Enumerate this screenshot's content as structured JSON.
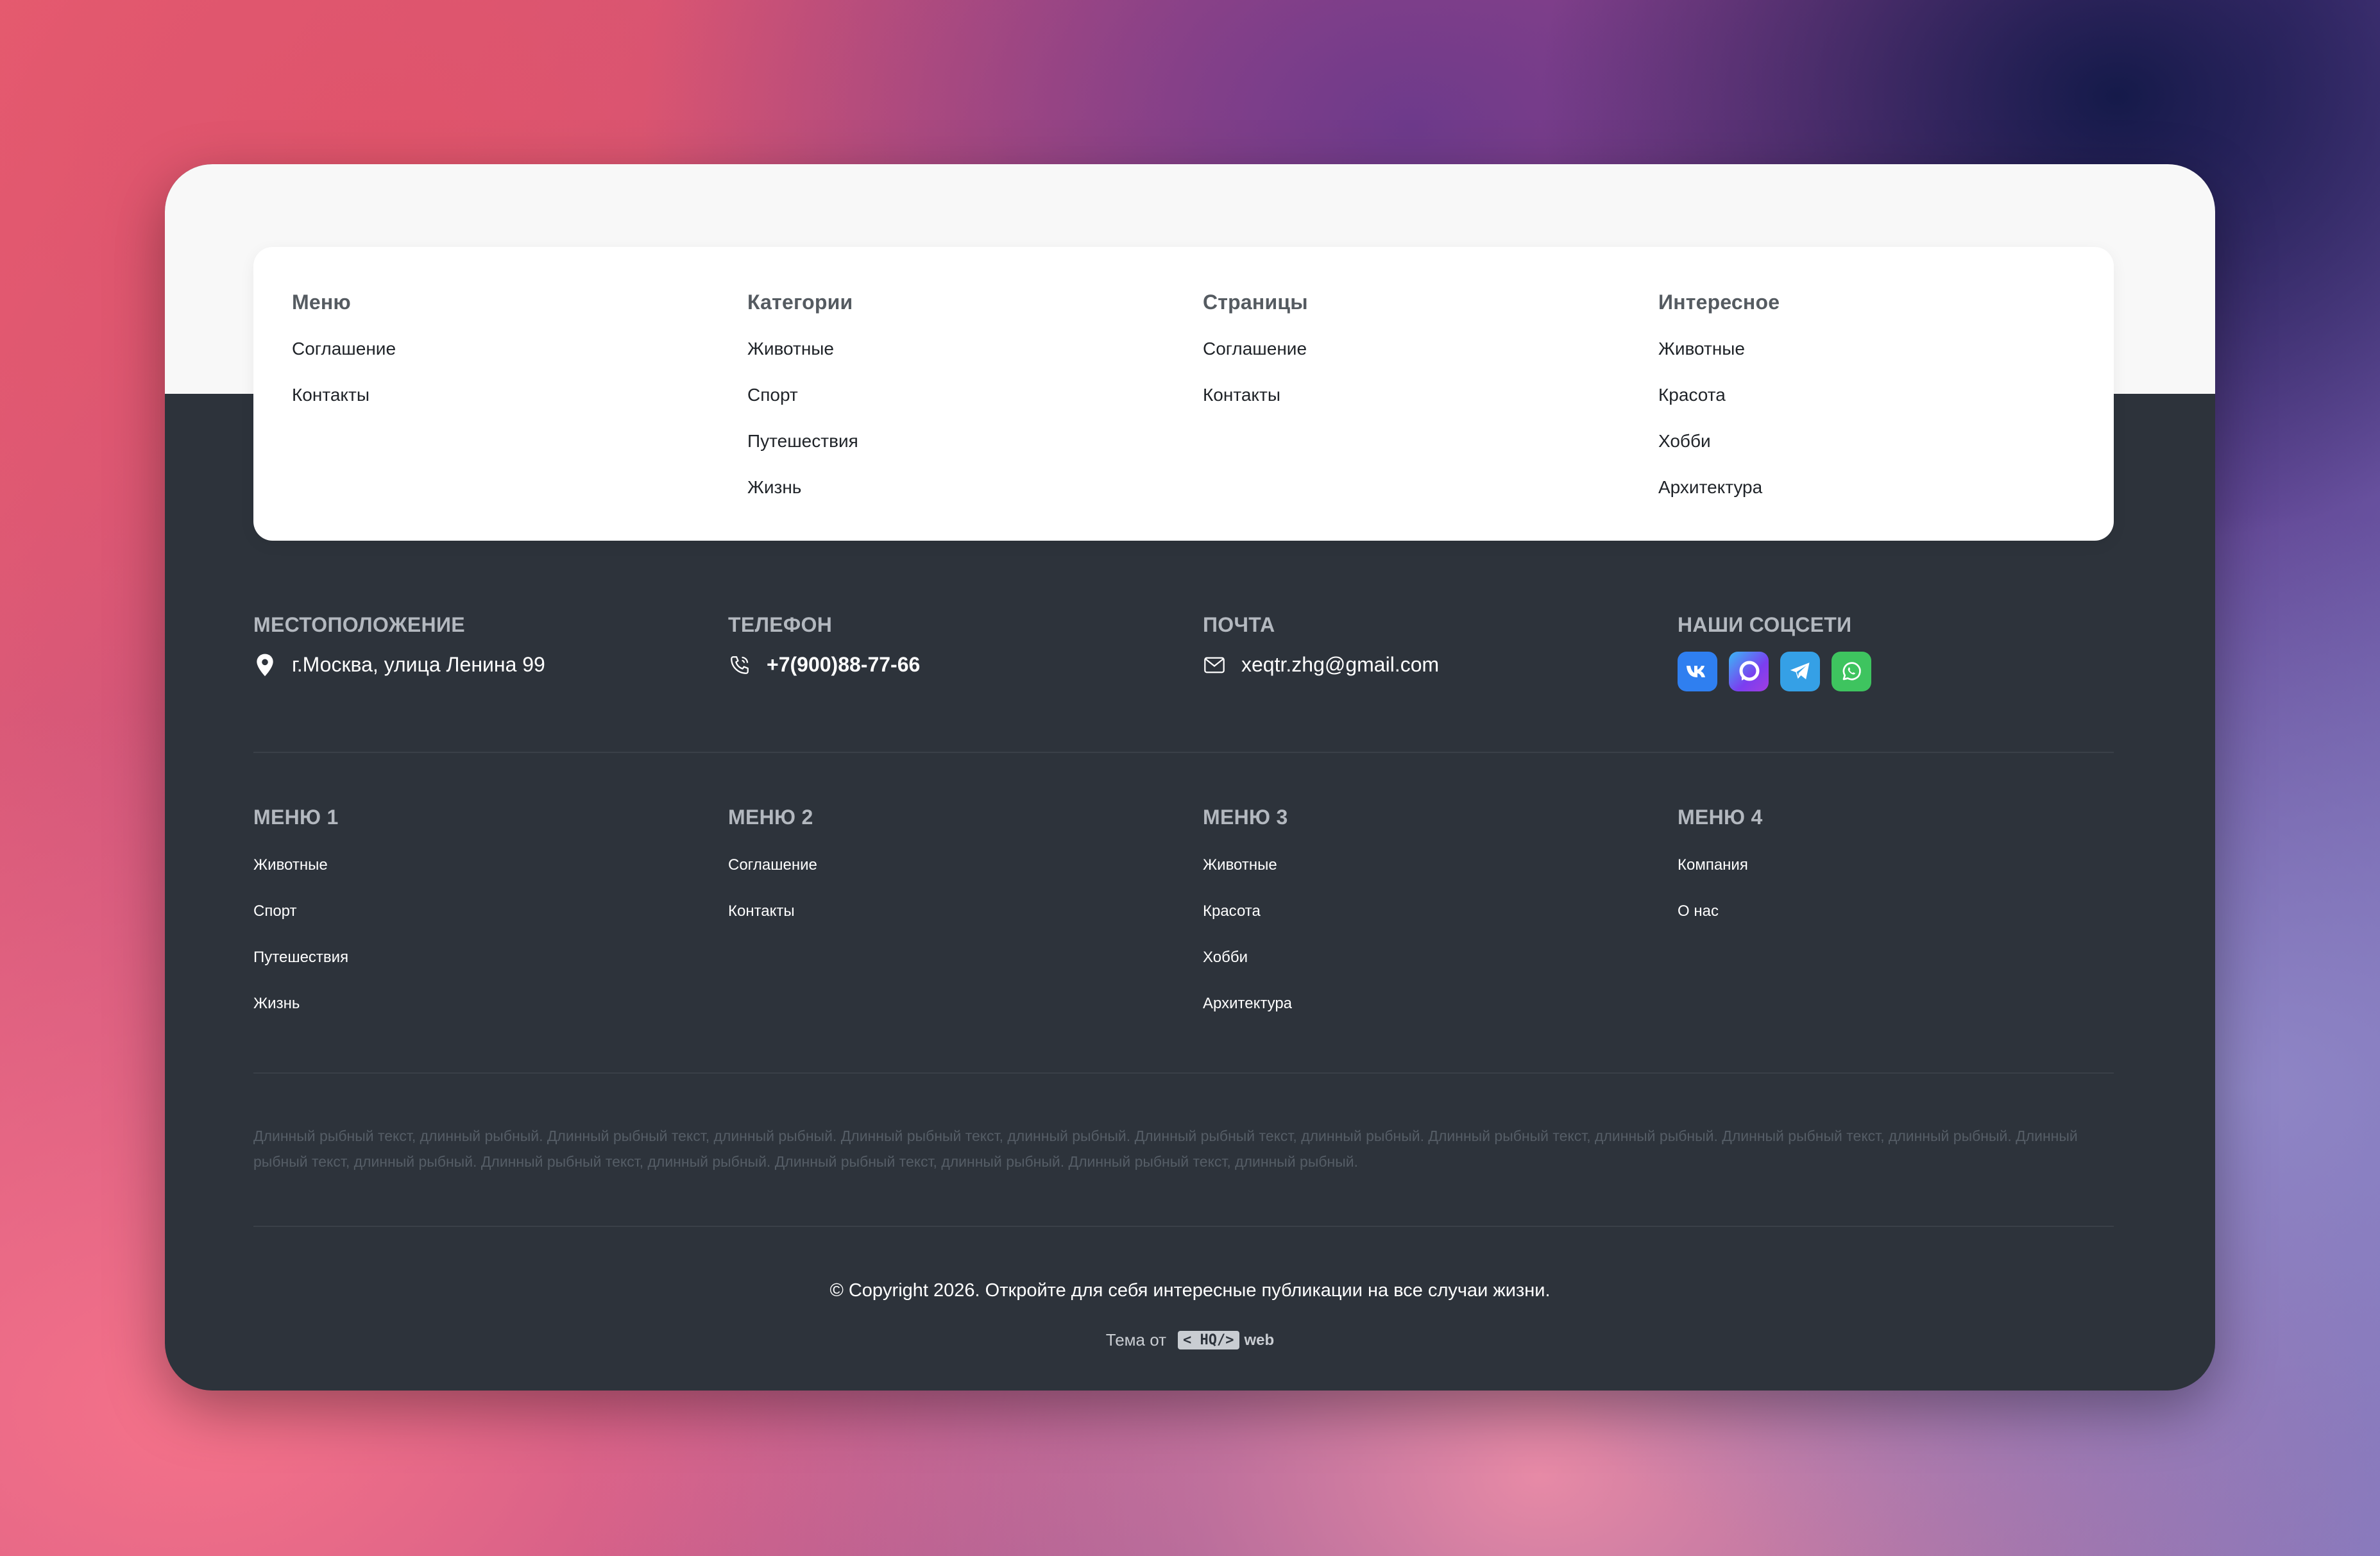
{
  "menu_panel": {
    "columns": [
      {
        "title": "Меню",
        "items": [
          "Соглашение",
          "Контакты"
        ]
      },
      {
        "title": "Категории",
        "items": [
          "Животные",
          "Спорт",
          "Путешествия",
          "Жизнь"
        ]
      },
      {
        "title": "Страницы",
        "items": [
          "Соглашение",
          "Контакты"
        ]
      },
      {
        "title": "Интересное",
        "items": [
          "Животные",
          "Красота",
          "Хобби",
          "Архитектура"
        ]
      }
    ]
  },
  "contacts": {
    "location": {
      "label": "МЕСТОПОЛОЖЕНИЕ",
      "value": "г.Москва, улица Ленина 99",
      "icon": "location-pin-icon"
    },
    "phone": {
      "label": "ТЕЛЕФОН",
      "value": "+7(900)88-77-66",
      "icon": "phone-icon"
    },
    "email": {
      "label": "ПОЧТА",
      "value": "xeqtr.zhg@gmail.com",
      "icon": "mail-icon"
    },
    "socials": {
      "label": "НАШИ СОЦСЕТИ",
      "items": [
        {
          "icon": "vk-icon",
          "color": "#2f7ff0"
        },
        {
          "icon": "max-messenger-icon",
          "color": "#6a4cf0"
        },
        {
          "icon": "telegram-icon",
          "color": "#35a0e6"
        },
        {
          "icon": "whatsapp-icon",
          "color": "#3ec45f"
        }
      ]
    }
  },
  "footer_menus": [
    {
      "title": "МЕНЮ 1",
      "items": [
        "Животные",
        "Спорт",
        "Путешествия",
        "Жизнь"
      ]
    },
    {
      "title": "МЕНЮ 2",
      "items": [
        "Соглашение",
        "Контакты"
      ]
    },
    {
      "title": "МЕНЮ 3",
      "items": [
        "Животные",
        "Красота",
        "Хобби",
        "Архитектура"
      ]
    },
    {
      "title": "МЕНЮ 4",
      "items": [
        "Компания",
        "О нас"
      ]
    }
  ],
  "fish_text": "Длинный рыбный текст, длинный рыбный. Длинный рыбный текст, длинный рыбный. Длинный рыбный текст, длинный рыбный. Длинный рыбный текст, длинный рыбный. Длинный рыбный текст, длинный рыбный. Длинный рыбный текст, длинный рыбный. Длинный рыбный текст, длинный рыбный. Длинный рыбный текст, длинный рыбный. Длинный рыбный текст, длинный рыбный. Длинный рыбный текст, длинный рыбный.",
  "copyright": "© Copyright 2026. Откройте для себя интересные публикации на все случаи жизни.",
  "theme": {
    "prefix": "Тема от",
    "logo_box": "< HQ/>",
    "logo_suffix": "web"
  }
}
